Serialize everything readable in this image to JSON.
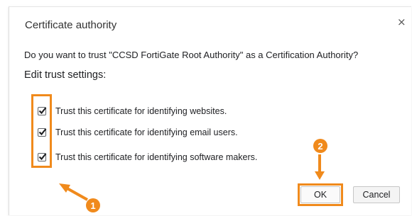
{
  "dialog": {
    "title": "Certificate authority",
    "close_icon": "×",
    "question": "Do you want to trust \"CCSD FortiGate Root Authority\" as a Certification Authority?",
    "section_heading": "Edit trust settings:",
    "options": [
      {
        "label": "Trust this certificate for identifying websites.",
        "checked": true
      },
      {
        "label": "Trust this certificate for identifying email users.",
        "checked": true
      },
      {
        "label": "Trust this certificate for identifying software makers.",
        "checked": true
      }
    ],
    "ok_label": "OK",
    "cancel_label": "Cancel"
  },
  "annotations": {
    "step1": "1",
    "step2": "2",
    "accent_color": "#f08a1c"
  }
}
